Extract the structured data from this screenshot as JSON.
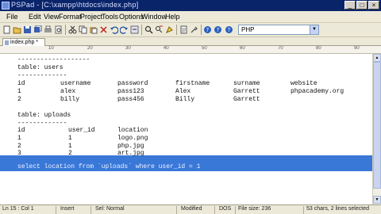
{
  "window": {
    "title": "PSPad - [C:\\xampp\\htdocs\\index.php]"
  },
  "menu": [
    "File",
    "Edit",
    "View",
    "Format",
    "Project",
    "Tools",
    "Options",
    "Window",
    "Help"
  ],
  "toolbar": {
    "language_select": "PHP"
  },
  "tabs": [
    {
      "label": "index.php *"
    }
  ],
  "ruler": [
    "10",
    "20",
    "30",
    "40",
    "50",
    "60",
    "70",
    "80",
    "90"
  ],
  "editor": {
    "lines": [
      {
        "kind": "text",
        "text": "-------------------"
      },
      {
        "kind": "text",
        "text": "table: users"
      },
      {
        "kind": "text",
        "text": "-------------"
      },
      {
        "kind": "row",
        "cells": [
          "id",
          "username",
          "password",
          "firstname",
          "surname",
          "website"
        ]
      },
      {
        "kind": "row",
        "cells": [
          "1",
          "alex",
          "pass123",
          "Alex",
          "Garrett",
          "phpacademy.org"
        ]
      },
      {
        "kind": "row",
        "cells": [
          "2",
          "billy",
          "pass456",
          "Billy",
          "Garrett",
          ""
        ]
      },
      {
        "kind": "text",
        "text": ""
      },
      {
        "kind": "text",
        "text": "table: uploads"
      },
      {
        "kind": "text",
        "text": "-------------"
      },
      {
        "kind": "row",
        "cells": [
          "id",
          "user_id",
          "location"
        ]
      },
      {
        "kind": "row",
        "cells": [
          "1",
          "1",
          "logo.png"
        ]
      },
      {
        "kind": "row",
        "cells": [
          "2",
          "1",
          "php.jpg"
        ]
      },
      {
        "kind": "row",
        "cells": [
          "3",
          "2",
          "art.jpg"
        ]
      },
      {
        "kind": "text",
        "text": ""
      },
      {
        "kind": "text",
        "text": "select location from `uploads` where user_id = 1"
      }
    ]
  },
  "status": {
    "position": "Ln 15 : Col 1",
    "insert": "Insert",
    "selection": "Sel: Normal",
    "modified": "Modified",
    "format": "DOS",
    "file_size": "File size: 236",
    "selection_info": "53 chars, 2 lines selected"
  }
}
